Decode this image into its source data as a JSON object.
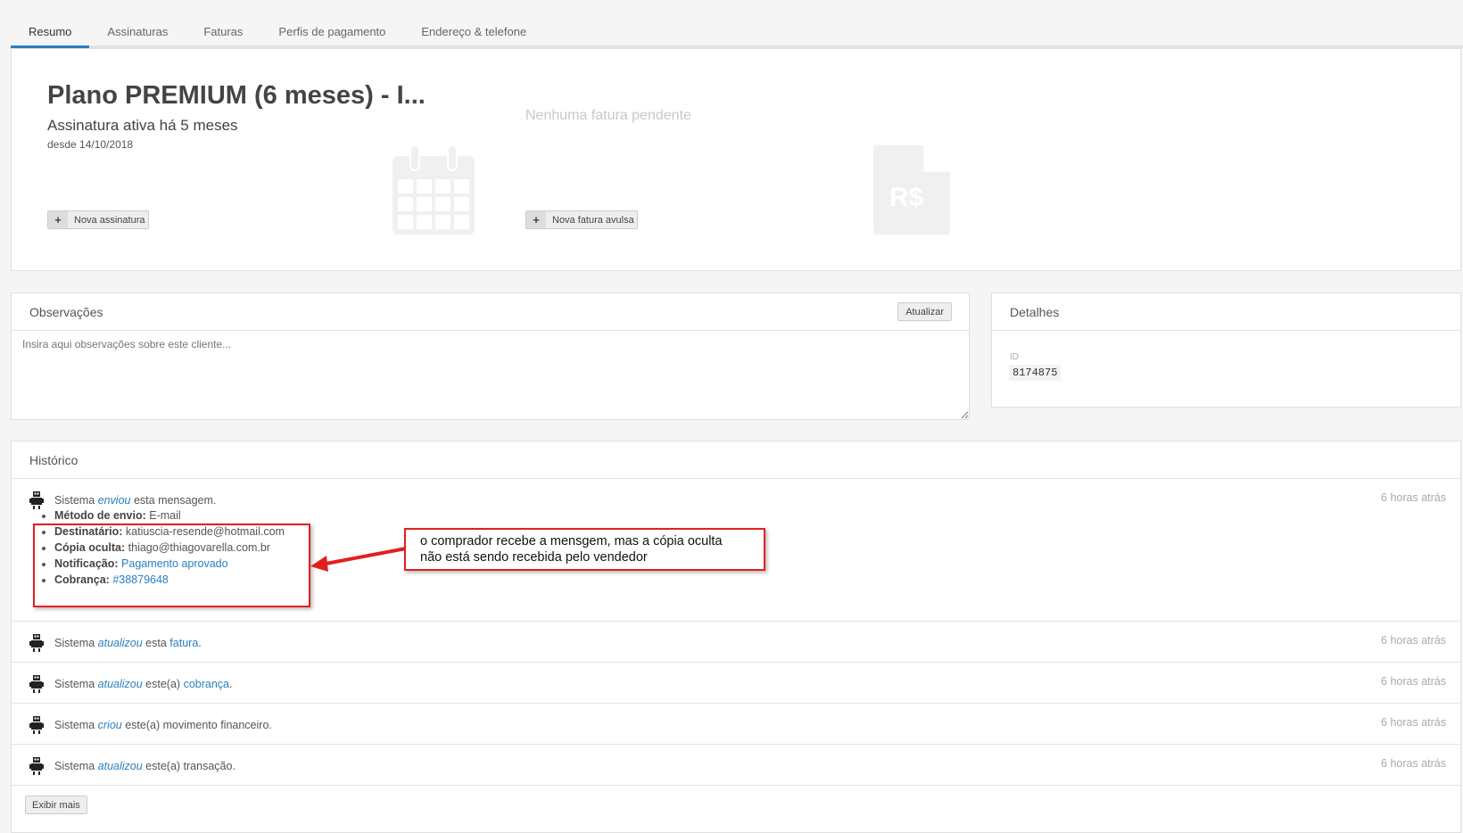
{
  "tabs": [
    "Resumo",
    "Assinaturas",
    "Faturas",
    "Perfis de pagamento",
    "Endereço & telefone"
  ],
  "summary": {
    "plan_title": "Plano PREMIUM (6 meses) - I...",
    "subtitle": "Assinatura ativa há 5 meses",
    "since": "desde 14/10/2018",
    "new_subscription": "Nova assinatura",
    "no_invoice": "Nenhuma fatura pendente",
    "new_invoice": "Nova fatura avulsa",
    "currency_icon_text": "R$"
  },
  "notes": {
    "title": "Observações",
    "update": "Atualizar",
    "placeholder": "Insira aqui observações sobre este cliente..."
  },
  "details": {
    "title": "Detalhes",
    "id_label": "ID",
    "id_value": "8174875"
  },
  "history": {
    "title": "Histórico",
    "items": [
      {
        "actor": "Sistema",
        "verb": "enviou",
        "rest": "esta mensagem.",
        "link": "",
        "end": "",
        "time": "6 horas atrás"
      },
      {
        "actor": "Sistema",
        "verb": "atualizou",
        "rest": "esta",
        "link": "fatura",
        "end": ".",
        "time": "6 horas atrás"
      },
      {
        "actor": "Sistema",
        "verb": "atualizou",
        "rest": "este(a)",
        "link": "cobrança",
        "end": ".",
        "time": "6 horas atrás"
      },
      {
        "actor": "Sistema",
        "verb": "criou",
        "rest": "este(a) movimento financeiro.",
        "link": "",
        "end": "",
        "time": "6 horas atrás"
      },
      {
        "actor": "Sistema",
        "verb": "atualizou",
        "rest": "este(a) transação.",
        "link": "",
        "end": "",
        "time": "6 horas atrás"
      }
    ],
    "message_details": [
      {
        "label": "Método de envio:",
        "value": "E-mail"
      },
      {
        "label": "Destinatário:",
        "value": "katiuscia-resende@hotmail.com"
      },
      {
        "label": "Cópia oculta:",
        "value": "thiago@thiagovarella.com.br"
      },
      {
        "label": "Notificação:",
        "value": "Pagamento aprovado"
      },
      {
        "label": "Cobrança:",
        "value": "#38879648"
      }
    ],
    "show_more": "Exibir mais"
  },
  "annotation": {
    "text_line1": "o comprador recebe a mensgem, mas a cópia oculta",
    "text_line2": "não está sendo recebida pelo vendedor",
    "color": "#e02020"
  }
}
